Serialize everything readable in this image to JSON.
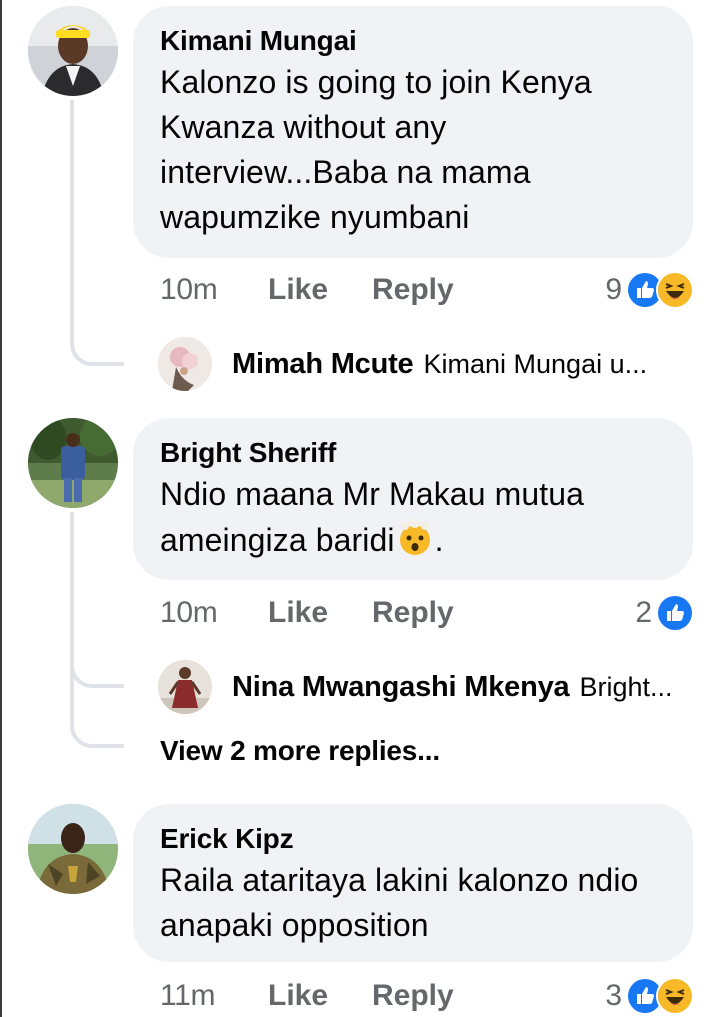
{
  "comments": [
    {
      "author": "Kimani Mungai",
      "text": "Kalonzo is going to join Kenya Kwanza without any interview...Baba na mama wapumzike nyumbani",
      "time": "10m",
      "like_label": "Like",
      "reply_label": "Reply",
      "reaction_count": "9",
      "reactions": [
        "like-icon",
        "haha-icon"
      ],
      "replies_preview": [
        {
          "author": "Mimah Mcute",
          "snippet": "Kimani Mungai u..."
        }
      ]
    },
    {
      "author": "Bright Sheriff",
      "text": "Ndio maana Mr Makau mutua ameingiza baridi",
      "text_suffix": ".",
      "inline_emoji": "exploding-head-emoji",
      "time": "10m",
      "like_label": "Like",
      "reply_label": "Reply",
      "reaction_count": "2",
      "reactions": [
        "like-icon"
      ],
      "replies_preview": [
        {
          "author": "Nina Mwangashi Mkenya",
          "snippet": "Bright..."
        }
      ],
      "more_replies_label": "View 2 more replies..."
    },
    {
      "author": "Erick Kipz",
      "text": "Raila ataritaya lakini kalonzo ndio anapaki opposition",
      "time": "11m",
      "like_label": "Like",
      "reply_label": "Reply",
      "reaction_count": "3",
      "reactions": [
        "like-icon",
        "haha-icon"
      ]
    }
  ],
  "colors": {
    "bubble": "#f0f2f5",
    "meta_text": "#65676b",
    "like_blue": "#1877f2",
    "haha_yellow": "#f7b928",
    "thread_line": "#dfe2e6"
  }
}
